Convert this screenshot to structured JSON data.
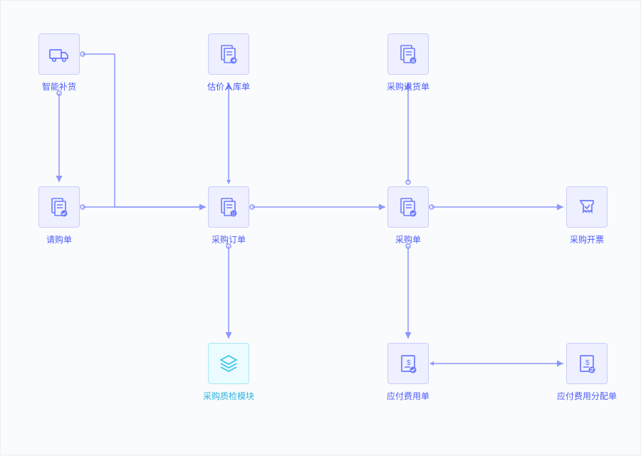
{
  "nodes": {
    "smart_restock": {
      "label": "智能补货",
      "icon": "truck"
    },
    "purchase_req": {
      "label": "请购单",
      "icon": "doc-check"
    },
    "valuation_in": {
      "label": "估价入库单",
      "icon": "doc-arrow"
    },
    "purchase_order": {
      "label": "采购订单",
      "icon": "doc-order"
    },
    "purchase_bill": {
      "label": "采购单",
      "icon": "doc-check"
    },
    "purchase_return": {
      "label": "采购退货单",
      "icon": "doc-return"
    },
    "purchase_invoice": {
      "label": "采购开票",
      "icon": "invoice"
    },
    "qc_module": {
      "label": "采购质检模块",
      "icon": "layers",
      "alt": true
    },
    "payable_fee": {
      "label": "应付费用单",
      "icon": "doc-money"
    },
    "payable_alloc": {
      "label": "应付费用分配单",
      "icon": "doc-swap"
    }
  },
  "colors": {
    "primary": "#6b7aff",
    "alt": "#3cc5e8"
  }
}
